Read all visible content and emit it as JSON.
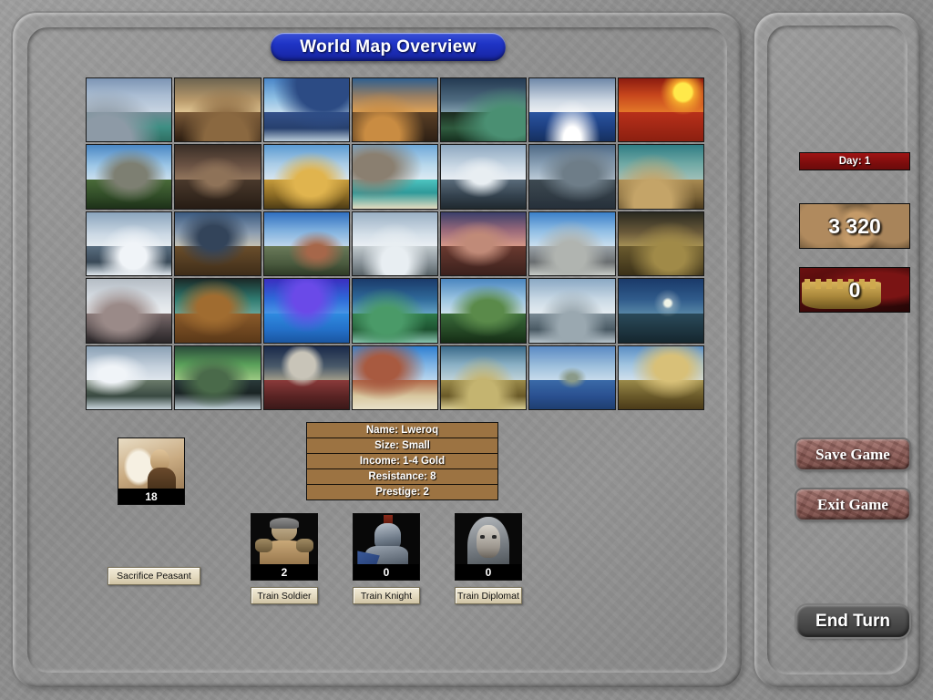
{
  "window": {
    "title": "World Map Overview"
  },
  "map": {
    "columns": 7,
    "rows": 5,
    "tiles": [
      {
        "name": "glacial-lake",
        "sky": "linear-gradient(180deg,#7d95b4 0%,#a9bcd2 45%,#cdd8e4 100%)",
        "ground": "linear-gradient(180deg,#6f8a93 0%,#3f8f84 50%,#2f6f63 100%)",
        "feat": "radial-gradient(ellipse at 22% 100%, #8d9aa6 0 28%, rgba(0,0,0,0) 60%)"
      },
      {
        "name": "desert-mesa-dusk",
        "sky": "linear-gradient(180deg,#6d6450 0%,#b99a6c 60%,#e8cf9c 100%)",
        "ground": "linear-gradient(180deg,#7a5a38 0%,#4a3420 60%,#2c1d10 100%)",
        "feat": "radial-gradient(ellipse at 60% 100%, #8a6840 0 30%, rgba(0,0,0,0) 62%)"
      },
      {
        "name": "blue-mountain-mist",
        "sky": "linear-gradient(180deg,#4a86c8 0%,#8fc0e4 55%,#cfe2ef 100%)",
        "ground": "linear-gradient(180deg,#35518a 0%,#27406e 55%,#b9cbd9 100%)",
        "feat": "radial-gradient(ellipse at 70% 10%, #2c4b84 0 32%, rgba(0,0,0,0) 60%)"
      },
      {
        "name": "sunset-peaks",
        "sky": "linear-gradient(180deg,#2f5f8f 0%,#9a7f62 50%,#e8a857 100%)",
        "ground": "linear-gradient(180deg,#5a4026 0%,#2e2014 100%)",
        "feat": "radial-gradient(ellipse at 35% 90%, #c98c42 0 22%, rgba(0,0,0,0) 55%)"
      },
      {
        "name": "dark-coast",
        "sky": "linear-gradient(180deg,#243a52 0%,#4f6b80 60%,#8aa6b4 100%)",
        "ground": "linear-gradient(180deg,#1b2a1e 0%,#2f5a3e 55%,#16301f 100%)",
        "feat": "radial-gradient(ellipse at 80% 70%, #4a8f72 0 24%, rgba(0,0,0,0) 58%)"
      },
      {
        "name": "open-ocean-sunrise",
        "sky": "linear-gradient(180deg,#6f88a8 0%,#cfd9e4 62%,#f2f4f6 100%)",
        "ground": "linear-gradient(180deg,#2b55a0 0%,#1d3f80 55%,#16305f 100%)",
        "feat": "radial-gradient(ellipse at 50% 96%, #ffffff 0 14%, rgba(0,0,0,0) 46%)"
      },
      {
        "name": "red-desert-sun",
        "sky": "linear-gradient(180deg,#8c1c10 0%,#c6451c 45%,#e8802a 100%)",
        "ground": "linear-gradient(180deg,#b8301a 0%,#8c1f10 100%)",
        "feat": "radial-gradient(circle at 76% 22%, #ffe94a 0 11%, #f4a62c 14%, rgba(0,0,0,0) 28%)"
      },
      {
        "name": "river-valley-citadel",
        "sky": "linear-gradient(180deg,#4a87c4 0%,#9cc6e6 55%,#d4e4f0 100%)",
        "ground": "linear-gradient(180deg,#4a6b3a 0%,#2f4a26 60%,#1d3018 100%)",
        "feat": "radial-gradient(ellipse at 52% 48%, #7d7f72 0 26%, rgba(0,0,0,0) 58%)"
      },
      {
        "name": "dark-spire",
        "sky": "linear-gradient(180deg,#3a2e26 0%,#6b5344 55%,#9a7d62 100%)",
        "ground": "linear-gradient(180deg,#4a392c 0%,#261c14 100%)",
        "feat": "radial-gradient(ellipse at 48% 52%, #8e7258 0 16%, rgba(0,0,0,0) 46%)"
      },
      {
        "name": "golden-crags",
        "sky": "linear-gradient(180deg,#5a9ad2 0%,#a8cbe6 50%,#dfeaf2 100%)",
        "ground": "linear-gradient(180deg,#c49a3c 0%,#8a6a24 55%,#4e3c16 100%)",
        "feat": "radial-gradient(ellipse at 55% 60%, #e0b44e 0 24%, rgba(0,0,0,0) 58%)"
      },
      {
        "name": "tropical-lagoon",
        "sky": "linear-gradient(180deg,#6fa8d8 0%,#b9d8ec 55%,#e4eef4 100%)",
        "ground": "linear-gradient(180deg,#4ec4c0 0%,#2f9a9a 45%,#e4dcc0 100%)",
        "feat": "radial-gradient(ellipse at 25% 35%, #8a7f70 0 22%, rgba(0,0,0,0) 54%)"
      },
      {
        "name": "snow-ridge",
        "sky": "linear-gradient(180deg,#8ea8c0 0%,#cddae6 60%,#eef2f6 100%)",
        "ground": "linear-gradient(180deg,#5a6b7a 0%,#34424e 55%,#20292f 100%)",
        "feat": "radial-gradient(ellipse at 48% 50%, #e8eef2 0 16%, rgba(0,0,0,0) 46%)"
      },
      {
        "name": "grey-spires",
        "sky": "linear-gradient(180deg,#4f6a86 0%,#8ea4b8 55%,#c4d2de 100%)",
        "ground": "linear-gradient(180deg,#3e4a52 0%,#26303a 100%)",
        "feat": "radial-gradient(ellipse at 60% 45%, #6e7d88 0 24%, rgba(0,0,0,0) 58%)"
      },
      {
        "name": "arid-plateau",
        "sky": "linear-gradient(180deg,#2f7d84 0%,#6fa8a4 50%,#a8c4bc 100%)",
        "ground": "linear-gradient(180deg,#a88a52 0%,#7a6236 60%,#4a3a1e 100%)",
        "feat": "radial-gradient(ellipse at 40% 90%, #c4a468 0 26%, rgba(0,0,0,0) 60%)"
      },
      {
        "name": "snowy-mountains",
        "sky": "linear-gradient(180deg,#8aa4bc 0%,#cbd8e4 60%,#e8eef2 100%)",
        "ground": "linear-gradient(180deg,#5a6e80 0%,#3a4a58 55%,#e0e8ee 100%)",
        "feat": "radial-gradient(ellipse at 55% 70%, #f0f4f8 0 20%, rgba(0,0,0,0) 52%)"
      },
      {
        "name": "fortress-hill",
        "sky": "linear-gradient(180deg,#3a5a80 0%,#8a9cb0 55%,#d0c8b4 100%)",
        "ground": "linear-gradient(180deg,#6a4e2c 0%,#3e2c18 100%)",
        "feat": "radial-gradient(ellipse at 45% 40%, #33445a 0 22%, rgba(0,0,0,0) 54%)"
      },
      {
        "name": "mesa-plains",
        "sky": "linear-gradient(180deg,#2f6fc0 0%,#7fb0de 50%,#c8dcee 100%)",
        "ground": "linear-gradient(180deg,#6a7a5a 0%,#4a5a3e 60%,#2e3a26 100%)",
        "feat": "radial-gradient(ellipse at 62% 62%, #a6674a 0 12%, rgba(0,0,0,0) 38%)"
      },
      {
        "name": "white-cliffs",
        "sky": "linear-gradient(180deg,#9ab0c4 0%,#d4dfe8 60%,#eef2f6 100%)",
        "ground": "linear-gradient(180deg,#c0c8cc 0%,#8a949a 55%,#5a6468 100%)",
        "feat": "radial-gradient(ellipse at 50% 80%, #e8eef2 0 22%, rgba(0,0,0,0) 56%)"
      },
      {
        "name": "crimson-spires",
        "sky": "linear-gradient(180deg,#3a3f6a 0%,#9a6a7a 50%,#e0a08a 100%)",
        "ground": "linear-gradient(180deg,#6a3a30 0%,#3a201c 100%)",
        "feat": "radial-gradient(ellipse at 45% 50%, #c08a78 0 20%, rgba(0,0,0,0) 52%)"
      },
      {
        "name": "grand-canyon",
        "sky": "linear-gradient(180deg,#3a7fc8 0%,#8fbde4 50%,#d4e4f0 100%)",
        "ground": "linear-gradient(180deg,#9aa2a8 0%,#6a6e70 55%,#c8ccc8 100%)",
        "feat": "radial-gradient(ellipse at 48% 70%, #b0b4b0 0 24%, rgba(0,0,0,0) 58%)"
      },
      {
        "name": "storm-ridge",
        "sky": "linear-gradient(180deg,#2a2a20 0%,#6a5a3a 55%,#b09a5a 100%)",
        "ground": "linear-gradient(180deg,#6a5a2e 0%,#3a3018 100%)",
        "feat": "radial-gradient(ellipse at 60% 70%, #a08a48 0 22%, rgba(0,0,0,0) 56%)"
      },
      {
        "name": "misty-gorge",
        "sky": "linear-gradient(180deg,#b4bcc4 0%,#d8dee4 55%,#eef0f2 100%)",
        "ground": "linear-gradient(180deg,#7a6a6a 0%,#4a4244 55%,#2a2628 100%)",
        "feat": "radial-gradient(ellipse at 40% 60%, #9a8a88 0 24%, rgba(0,0,0,0) 58%)"
      },
      {
        "name": "teal-dunes",
        "sky": "linear-gradient(180deg,#1a2a28 0%,#2f7a70 55%,#6aa89c 100%)",
        "ground": "linear-gradient(180deg,#8a5a2a 0%,#5a3818 100%)",
        "feat": "radial-gradient(ellipse at 45% 45%, #a06c30 0 24%, rgba(0,0,0,0) 58%)"
      },
      {
        "name": "blue-lake-night",
        "sky": "linear-gradient(180deg,#3a2ec0 0%,#2f6ad8 55%,#4a9ae8 100%)",
        "ground": "linear-gradient(180deg,#2f8ae0 0%,#2470c8 55%,#1a55a0 100%)",
        "feat": "radial-gradient(ellipse at 50% 30%, #6a4ae8 0 22%, rgba(0,0,0,0) 55%)"
      },
      {
        "name": "green-shallows",
        "sky": "linear-gradient(180deg,#1a3a6a 0%,#2f6a9a 55%,#6aa8c8 100%)",
        "ground": "linear-gradient(180deg,#2f7a4a 0%,#1d5230 55%,#8ac4b0 100%)",
        "feat": "radial-gradient(ellipse at 40% 65%, #4a9a68 0 22%, rgba(0,0,0,0) 56%)"
      },
      {
        "name": "green-peaks",
        "sky": "linear-gradient(180deg,#4a86c0 0%,#9ac4e0 55%,#d4e4ee 100%)",
        "ground": "linear-gradient(180deg,#3a6a3a 0%,#264a26 55%,#152c15 100%)",
        "feat": "radial-gradient(ellipse at 55% 50%, #5a8a4a 0 24%, rgba(0,0,0,0) 58%)"
      },
      {
        "name": "coastal-haze",
        "sky": "linear-gradient(180deg,#8aa8c4 0%,#c8d8e4 55%,#e8eef2 100%)",
        "ground": "linear-gradient(180deg,#7a8a94 0%,#4a5a64 55%,#b8c4cc 100%)",
        "feat": "radial-gradient(ellipse at 50% 75%, #9aa8b0 0 22%, rgba(0,0,0,0) 56%)"
      },
      {
        "name": "lighthouse-isle",
        "sky": "linear-gradient(180deg,#1a3a6a 0%,#2f5a8a 55%,#5a8aa8 100%)",
        "ground": "linear-gradient(180deg,#2a4a5a 0%,#15262e 100%)",
        "feat": "radial-gradient(circle at 58% 38%, #f0f4e8 0 5%, rgba(240,244,232,0.3) 9%, rgba(0,0,0,0) 22%)"
      },
      {
        "name": "arctic-shelf",
        "sky": "linear-gradient(180deg,#8aa0b4 0%,#c4d0dc 55%,#e4eaf0 100%)",
        "ground": "linear-gradient(180deg,#6a7a6a 0%,#3a4a42 55%,#c8d4dc 100%)",
        "feat": "radial-gradient(ellipse at 30% 45%, #f0f4f8 0 16%, rgba(0,0,0,0) 44%)"
      },
      {
        "name": "aurora-tundra",
        "sky": "linear-gradient(180deg,#2a4a3a 0%,#5aa05a 50%,#a8d08a 100%)",
        "ground": "linear-gradient(180deg,#2a3a3a 0%,#1a2424 45%,#c4d4dc 100%)",
        "feat": "radial-gradient(ellipse at 45% 55%, #4a6a4a 0 22%, rgba(0,0,0,0) 56%)"
      },
      {
        "name": "alien-moon-valley",
        "sky": "linear-gradient(180deg,#1a2a4a 0%,#4a5a6a 55%,#b0a890 100%)",
        "ground": "linear-gradient(180deg,#8a3a3a 0%,#5a2424 55%,#3a1818 100%)",
        "feat": "radial-gradient(circle at 45% 30%, #c8c4b8 0 20%, rgba(0,0,0,0) 34%)"
      },
      {
        "name": "red-mesa-grass",
        "sky": "linear-gradient(180deg,#2f7fd0 0%,#7fb4e4 50%,#c4dcf0 100%)",
        "ground": "linear-gradient(180deg,#b06a4a 0%,#d8c8a0 55%,#e8e0c8 100%)",
        "feat": "radial-gradient(ellipse at 35% 35%, #a85a40 0 22%, rgba(0,0,0,0) 56%)"
      },
      {
        "name": "dry-savanna",
        "sky": "linear-gradient(180deg,#3a6a8a 0%,#8ab0c4 50%,#c8d8dc 100%)",
        "ground": "linear-gradient(180deg,#9a8a4a 0%,#6a5a28 55%,#d8cc90 100%)",
        "feat": "radial-gradient(ellipse at 50% 80%, #c4b470 0 24%, rgba(0,0,0,0) 58%)"
      },
      {
        "name": "island-sea",
        "sky": "linear-gradient(180deg,#5a8ac4 0%,#9ec0dc 55%,#cfe0ee 100%)",
        "ground": "linear-gradient(180deg,#3a6aa8 0%,#2a5090 55%,#1e3e70 100%)",
        "feat": "radial-gradient(ellipse at 50% 50%, #8a9a8a 0 8%, rgba(0,0,0,0) 24%)"
      },
      {
        "name": "golden-butte",
        "sky": "linear-gradient(180deg,#5a8ec4 0%,#a0c4e0 50%,#d8e4ee 100%)",
        "ground": "linear-gradient(180deg,#9a8a4a 0%,#6a5a2a 55%,#4a3a18 100%)",
        "feat": "radial-gradient(ellipse at 62% 35%, #d8c078 0 22%, rgba(0,0,0,0) 54%)"
      }
    ]
  },
  "territory_info": {
    "rows": [
      "Name:  Lweroq",
      "Size:  Small",
      "Income:  1-4 Gold",
      "Resistance: 8",
      "Prestige: 2"
    ]
  },
  "peasant": {
    "count": "18",
    "action_label": "Sacrifice Peasant",
    "portrait_name": "peasant-portrait"
  },
  "units": [
    {
      "name": "soldier",
      "count": "2",
      "action_label": "Train Soldier"
    },
    {
      "name": "knight",
      "count": "0",
      "action_label": "Train Knight"
    },
    {
      "name": "diplomat",
      "count": "0",
      "action_label": "Train Diplomat"
    }
  ],
  "status": {
    "day_label": "Day: 1",
    "gold": "3 320",
    "prestige": "0"
  },
  "actions": {
    "save_game": "Save Game",
    "exit_game": "Exit Game",
    "end_turn": "End Turn"
  },
  "colors": {
    "title_blue": "#1f34c6",
    "day_red": "#7d0d0d",
    "stone_button": "#8b5a55",
    "wood": "#9c7342"
  }
}
